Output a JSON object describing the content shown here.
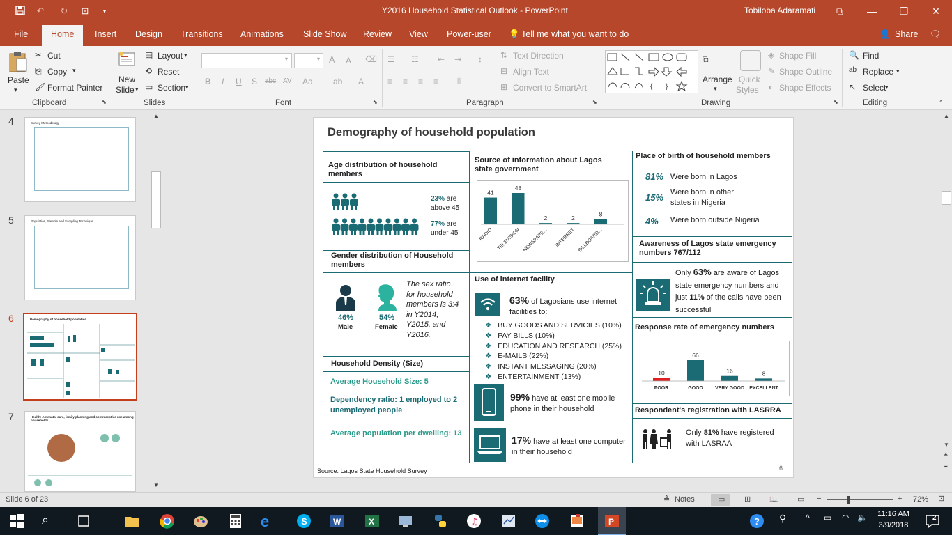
{
  "window": {
    "title": "Y2016 Household Statistical Outlook  -  PowerPoint",
    "user": "Tobiloba Adaramati"
  },
  "tabs": [
    "File",
    "Home",
    "Insert",
    "Design",
    "Transitions",
    "Animations",
    "Slide Show",
    "Review",
    "View",
    "Power-user"
  ],
  "tell_me": "Tell me what you want to do",
  "share": "Share",
  "ribbon": {
    "clipboard": {
      "paste": "Paste",
      "cut": "Cut",
      "copy": "Copy",
      "format_painter": "Format Painter",
      "label": "Clipboard"
    },
    "slides": {
      "new_slide_1": "New",
      "new_slide_2": "Slide",
      "layout": "Layout",
      "reset": "Reset",
      "section": "Section",
      "label": "Slides"
    },
    "font": {
      "label": "Font"
    },
    "paragraph": {
      "text_direction": "Text Direction",
      "align_text": "Align Text",
      "convert": "Convert to SmartArt",
      "label": "Paragraph"
    },
    "drawing": {
      "arrange": "Arrange",
      "quick_1": "Quick",
      "quick_2": "Styles",
      "shape_fill": "Shape Fill",
      "shape_outline": "Shape Outline",
      "shape_effects": "Shape Effects",
      "label": "Drawing"
    },
    "editing": {
      "find": "Find",
      "replace": "Replace",
      "select": "Select",
      "label": "Editing"
    }
  },
  "thumbs": [
    {
      "num": "4",
      "title": "Survey Methodology"
    },
    {
      "num": "5",
      "title": "Population, Sample and Sampling Technique"
    },
    {
      "num": "6",
      "title": "Demography of household population"
    },
    {
      "num": "7",
      "title": "Health: Antenatal care, family planning and contraceptive use among households"
    }
  ],
  "slide": {
    "title": "Demography of household population",
    "age": {
      "heading": "Age distribution of household members",
      "r1": "23%",
      "r1b": "are",
      "r1c": "above 45",
      "r2": "77%",
      "r2b": "are",
      "r2c": "under 45"
    },
    "gender": {
      "heading": "Gender distribution of Household members",
      "male_pct": "46%",
      "male": "Male",
      "female_pct": "54%",
      "female": "Female",
      "note": "The sex ratio for household members is 3:4 in Y2014, Y2015, and Y2016."
    },
    "density": {
      "heading": "Household Density (Size)",
      "l1": "Average Household Size: 5",
      "l2": "Dependency ratio: 1 employed to 2 unemployed people",
      "l3": "Average population per dwelling: 13"
    },
    "source": {
      "heading": "Source of information about Lagos state government"
    },
    "internet": {
      "heading": "Use of internet facility",
      "p1": "63%",
      "p1t": "of Lagosians use internet facilities to:",
      "items": [
        "BUY GOODS AND SERVICIES (10%)",
        "PAY BILLS (10%)",
        "EDUCATION AND RESEARCH (25%)",
        "E-MAILS (22%)",
        "INSTANT MESSAGING (20%)",
        "ENTERTAINMENT (13%)"
      ],
      "mobile_pct": "99%",
      "mobile": "have at least one mobile phone in their household",
      "comp_pct": "17%",
      "comp": "have at least one computer in their household"
    },
    "birth": {
      "heading": "Place of birth of household members",
      "rows": [
        {
          "pct": "81%",
          "text": "Were born in Lagos"
        },
        {
          "pct": "15%",
          "text": "Were born in other states in Nigeria"
        },
        {
          "pct": "4%",
          "text": "Were born outside Nigeria"
        }
      ]
    },
    "awareness": {
      "heading": "Awareness of Lagos state emergency numbers 767/112",
      "a": "Only",
      "pct": "63%",
      "b": "are aware of Lagos state emergency numbers and just",
      "pct2": "11%",
      "c": "of the calls have been successful"
    },
    "response": {
      "heading": "Response rate of emergency numbers"
    },
    "lasrra": {
      "heading": "Respondent's registration with LASRRA",
      "a": "Only",
      "pct": "81%",
      "b": "have registered with LASRAA"
    },
    "source_note": "Source:  Lagos State Household Survey",
    "page_num": "6"
  },
  "chart_data": [
    {
      "type": "bar",
      "categories": [
        "RADIO",
        "TELEVISION",
        "NEWSPAPE...",
        "INTERNET",
        "BILLBOARD..."
      ],
      "values": [
        41,
        48,
        2,
        2,
        8
      ],
      "color": "#1a6b73"
    },
    {
      "type": "bar",
      "categories": [
        "POOR",
        "GOOD",
        "VERY GOOD",
        "EXCELLENT"
      ],
      "values": [
        10,
        66,
        16,
        8
      ],
      "colors": [
        "#e02020",
        "#1a6b73",
        "#1a6b73",
        "#1a6b73"
      ]
    }
  ],
  "status": {
    "slide": "Slide 6 of 23",
    "notes": "Notes",
    "zoom": "72%"
  },
  "taskbar": {
    "time": "11:16 AM",
    "date": "3/9/2018",
    "badge": "2"
  }
}
